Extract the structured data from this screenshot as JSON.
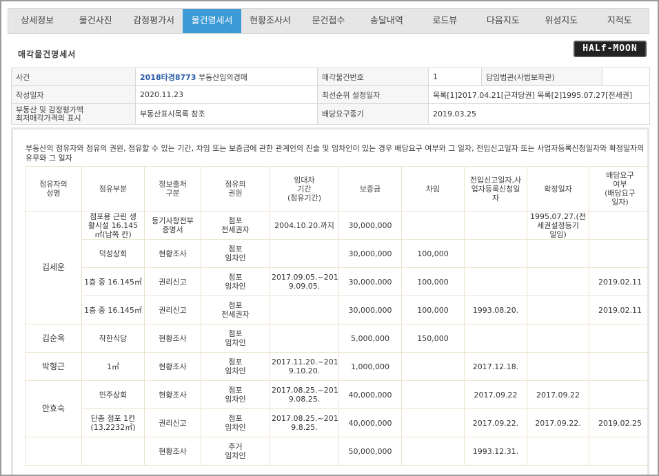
{
  "tabs": [
    "상세정보",
    "물건사진",
    "감정평가서",
    "물건명세서",
    "현황조사서",
    "문건접수",
    "송달내역",
    "로드뷰",
    "다음지도",
    "위성지도",
    "지적도"
  ],
  "active_tab_index": 3,
  "page_title": "매각물건명세서",
  "logo_text": "HALf-MOON",
  "info": {
    "case_label": "사건",
    "case_number": "2018타경8773",
    "case_type": "부동산임의경매",
    "item_no_label": "매각물건번호",
    "item_no": "1",
    "judge_label": "담임법관(사법보좌관)",
    "judge_value": "",
    "written_date_label": "작성일자",
    "written_date": "2020.11.23",
    "priority_label": "최선순위 설정일자",
    "priority_value": "목록[1]2017.04.21[근저당권] 목록[2]1995.07.27[전세권]",
    "appraisal_label_1": "부동산 및 감정평가액",
    "appraisal_label_2": "최저매각가격의 표시",
    "appraisal_value": "부동산표시목록 참조",
    "deadline_label": "배당요구종기",
    "deadline_value": "2019.03.25"
  },
  "description": "부동산의 점유자와 점유의 권원, 점유할 수 있는 기간, 차임 또는 보증금에 관한 관계인의 진술 및 임차인이 있는 경우 배당요구 여부와 그 일자, 전입신고일자 또는 사업자등록신청일자와 확정일자의 유무와 그 일자",
  "occupancy_table": {
    "headers": [
      "점유자의\n성명",
      "점유부분",
      "정보출처\n구분",
      "점유의\n권원",
      "임대차\n기간\n(점유기간)",
      "보증금",
      "차임",
      "전입신고일자,사\n업자등록신청일\n자",
      "확정일자",
      "배당요구\n여부\n(배당요구\n일자)"
    ],
    "groups": [
      {
        "name": "김세운",
        "rows": [
          [
            "점포용 근린 생\n활시설 16.145\n㎡(남쪽 칸)",
            "등기사항전부\n증명서",
            "점포\n전세권자",
            "2004.10.20.까지",
            "30,000,000",
            "",
            "",
            "1995.07.27.(전\n세권설정등기\n일임)",
            ""
          ],
          [
            "덕성상회",
            "현황조사",
            "점포\n임차인",
            "",
            "30,000,000",
            "100,000",
            "",
            "",
            ""
          ],
          [
            "1층 중 16.145㎡",
            "권리신고",
            "점포\n임차인",
            "2017.09.05.~201\n9.09.05.",
            "30,000,000",
            "100,000",
            "",
            "",
            "2019.02.11"
          ],
          [
            "1층 중 16.145㎡",
            "권리신고",
            "점포\n전세권자",
            "",
            "30,000,000",
            "100,000",
            "1993.08.20.",
            "",
            "2019.02.11"
          ]
        ]
      },
      {
        "name": "김순옥",
        "rows": [
          [
            "착한식당",
            "현황조사",
            "점포\n임차인",
            "",
            "5,000,000",
            "150,000",
            "",
            "",
            ""
          ]
        ]
      },
      {
        "name": "박형근",
        "rows": [
          [
            "1㎡",
            "현황조사",
            "점포\n임차인",
            "2017.11.20.~201\n9.10.20.",
            "1,000,000",
            "",
            "2017.12.18.",
            "",
            ""
          ]
        ]
      },
      {
        "name": "안효숙",
        "rows": [
          [
            "민주상회",
            "현황조사",
            "점포\n임차인",
            "2017.08.25.~201\n9.08.25.",
            "40,000,000",
            "",
            "2017.09.22",
            "2017.09.22",
            ""
          ],
          [
            "단층 점포 1칸\n(13.2232㎡)",
            "권리신고",
            "점포\n임차인",
            "2017.08.25.~201\n9.8.25.",
            "40,000,000",
            "",
            "2017.09.22.",
            "2017.09.22.",
            "2019.02.25"
          ]
        ]
      },
      {
        "name": "",
        "rows": [
          [
            "",
            "현황조사",
            "주거\n임차인",
            "",
            "50,000,000",
            "",
            "1993.12.31.",
            "",
            ""
          ]
        ]
      }
    ]
  },
  "colors": {
    "active_tab": "#3c9ad6",
    "case_number": "#2a5caa",
    "table_border": "#ece2cf"
  }
}
